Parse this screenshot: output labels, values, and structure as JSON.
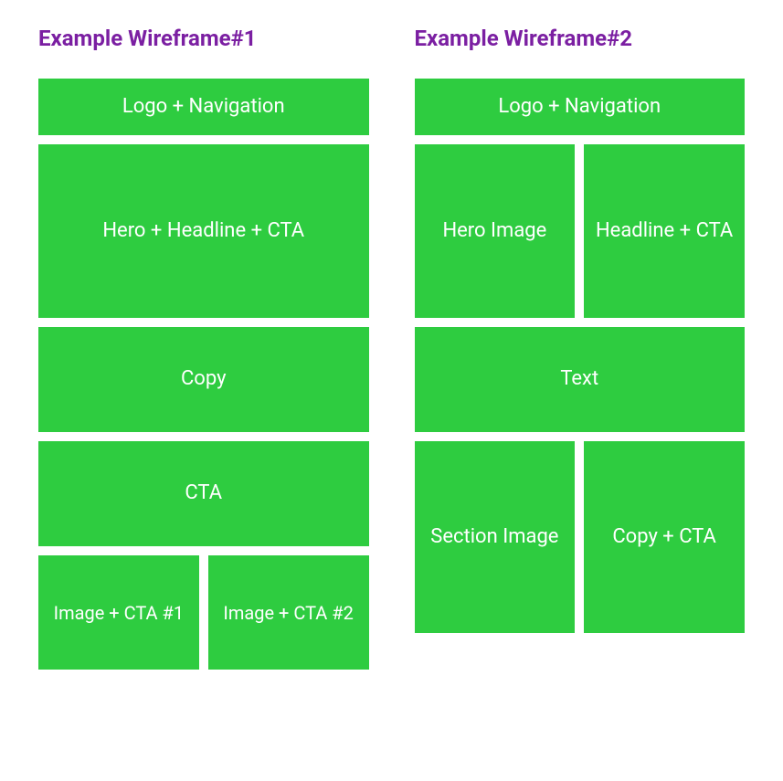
{
  "wireframe1": {
    "title": "Example Wireframe#1",
    "blocks": {
      "nav": "Logo + Navigation",
      "hero": "Hero + Headline + CTA",
      "copy": "Copy",
      "cta": "CTA",
      "imgcta1": "Image + CTA #1",
      "imgcta2": "Image + CTA #2"
    }
  },
  "wireframe2": {
    "title": "Example Wireframe#2",
    "blocks": {
      "nav": "Logo + Navigation",
      "heroimg": "Hero Image",
      "headline": "Headline + CTA",
      "text": "Text",
      "sectionimg": "Section Image",
      "copycta": "Copy + CTA"
    }
  }
}
